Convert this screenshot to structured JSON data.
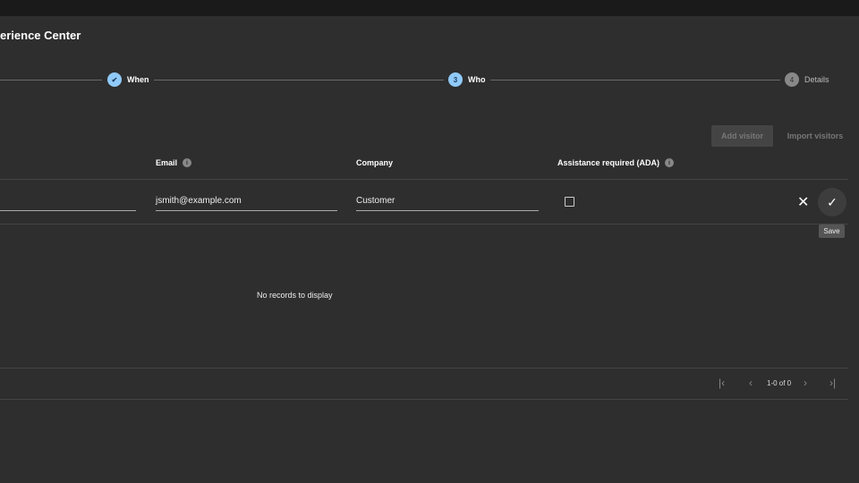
{
  "header": {
    "title": "erience Center"
  },
  "stepper": [
    {
      "label": "When",
      "state": "done"
    },
    {
      "label": "Who",
      "number": "3",
      "state": "active"
    },
    {
      "label": "Details",
      "number": "4",
      "state": "pending"
    }
  ],
  "toolbar": {
    "add_visitor": "Add visitor",
    "import_visitors": "Import visitors"
  },
  "columns": {
    "email": "Email",
    "company": "Company",
    "ada": "Assistance required (ADA)"
  },
  "edit_row": {
    "email": "jsmith@example.com",
    "company": "Customer",
    "ada_checked": false,
    "save_tooltip": "Save"
  },
  "empty_message": "No records to display",
  "pagination": {
    "range": "1-0 of 0"
  },
  "colors": {
    "accent": "#90caf9",
    "background": "#2e2e2e"
  }
}
